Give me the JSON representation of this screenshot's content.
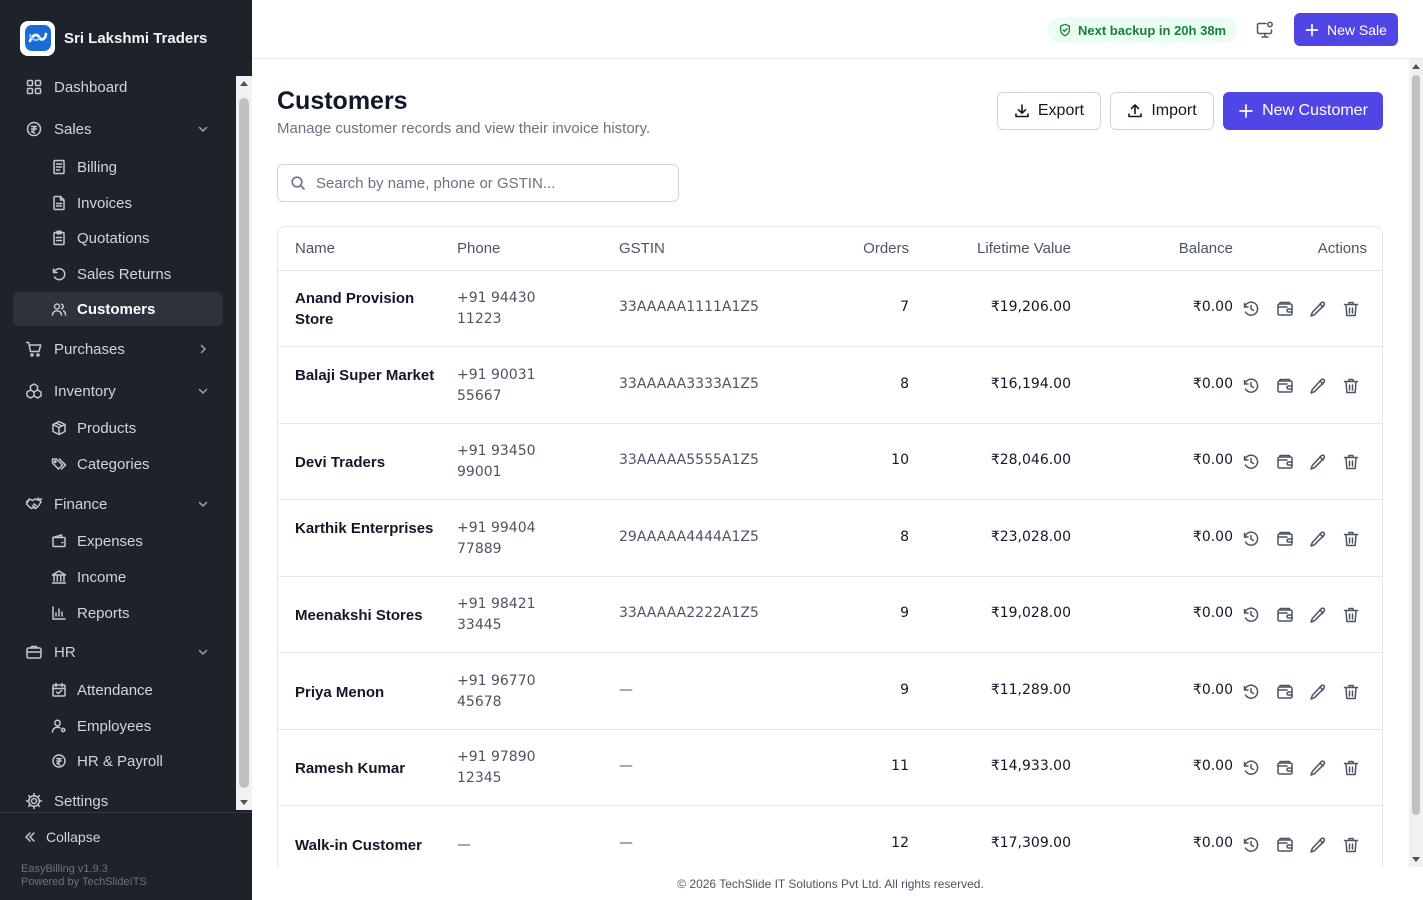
{
  "app": {
    "brand_name": "Sri Lakshmi Traders",
    "accent": "#4f46e5",
    "sidebar_bg": "#1e222a"
  },
  "sidebar": {
    "items": [
      {
        "label": "Dashboard",
        "icon": "dashboard-grid-icon",
        "level": "top"
      },
      {
        "label": "Sales",
        "icon": "sales-coin-icon",
        "level": "top",
        "expanded": true
      },
      {
        "label": "Billing",
        "icon": "billing-icon",
        "level": "sub"
      },
      {
        "label": "Invoices",
        "icon": "invoice-file-icon",
        "level": "sub"
      },
      {
        "label": "Quotations",
        "icon": "clipboard-icon",
        "level": "sub"
      },
      {
        "label": "Sales Returns",
        "icon": "return-arrow-icon",
        "level": "sub"
      },
      {
        "label": "Customers",
        "icon": "users-icon",
        "level": "sub",
        "active": true
      },
      {
        "label": "Purchases",
        "icon": "cart-icon",
        "level": "top",
        "expanded": false
      },
      {
        "label": "Inventory",
        "icon": "boxes-icon",
        "level": "top",
        "expanded": true
      },
      {
        "label": "Products",
        "icon": "package-icon",
        "level": "sub"
      },
      {
        "label": "Categories",
        "icon": "tags-icon",
        "level": "sub"
      },
      {
        "label": "Finance",
        "icon": "handshake-icon",
        "level": "top",
        "expanded": true
      },
      {
        "label": "Expenses",
        "icon": "wallet-icon",
        "level": "sub"
      },
      {
        "label": "Income",
        "icon": "bank-icon",
        "level": "sub"
      },
      {
        "label": "Reports",
        "icon": "bar-chart-icon",
        "level": "sub"
      },
      {
        "label": "HR",
        "icon": "briefcase-icon",
        "level": "top",
        "expanded": true
      },
      {
        "label": "Attendance",
        "icon": "calendar-check-icon",
        "level": "sub"
      },
      {
        "label": "Employees",
        "icon": "user-cog-icon",
        "level": "sub"
      },
      {
        "label": "HR & Payroll",
        "icon": "payroll-coin-icon",
        "level": "sub"
      },
      {
        "label": "Settings",
        "icon": "gear-icon",
        "level": "top"
      }
    ],
    "collapse_label": "Collapse",
    "version": "EasyBilling v1.9.3",
    "powered_by": "Powered by TechSlideITS"
  },
  "topbar": {
    "backup_text": "Next backup in 20h 38m",
    "new_sale_label": "New Sale"
  },
  "page": {
    "title": "Customers",
    "subtitle": "Manage customer records and view their invoice history.",
    "export_label": "Export",
    "import_label": "Import",
    "new_customer_label": "New Customer",
    "search_placeholder": "Search by name, phone or GSTIN..."
  },
  "table": {
    "headers": {
      "name": "Name",
      "phone": "Phone",
      "gstin": "GSTIN",
      "orders": "Orders",
      "lifetime": "Lifetime Value",
      "balance": "Balance",
      "actions": "Actions"
    },
    "rows": [
      {
        "name": "Anand Provision Store",
        "phone": "+91 94430 11223",
        "gstin": "33AAAAA1111A1Z5",
        "orders": "7",
        "lifetime": "₹19,206.00",
        "balance": "₹0.00"
      },
      {
        "name": "Balaji Super Market",
        "phone": "+91 90031 55667",
        "gstin": "33AAAAA3333A1Z5",
        "orders": "8",
        "lifetime": "₹16,194.00",
        "balance": "₹0.00"
      },
      {
        "name": "Devi Traders",
        "phone": "+91 93450 99001",
        "gstin": "33AAAAA5555A1Z5",
        "orders": "10",
        "lifetime": "₹28,046.00",
        "balance": "₹0.00"
      },
      {
        "name": "Karthik Enterprises",
        "phone": "+91 99404 77889",
        "gstin": "29AAAAA4444A1Z5",
        "orders": "8",
        "lifetime": "₹23,028.00",
        "balance": "₹0.00"
      },
      {
        "name": "Meenakshi Stores",
        "phone": "+91 98421 33445",
        "gstin": "33AAAAA2222A1Z5",
        "orders": "9",
        "lifetime": "₹19,028.00",
        "balance": "₹0.00"
      },
      {
        "name": "Priya Menon",
        "phone": "+91 96770 45678",
        "gstin": "—",
        "orders": "9",
        "lifetime": "₹11,289.00",
        "balance": "₹0.00"
      },
      {
        "name": "Ramesh Kumar",
        "phone": "+91 97890 12345",
        "gstin": "—",
        "orders": "11",
        "lifetime": "₹14,933.00",
        "balance": "₹0.00"
      },
      {
        "name": "Walk-in Customer",
        "phone": "—",
        "gstin": "—",
        "orders": "12",
        "lifetime": "₹17,309.00",
        "balance": "₹0.00"
      }
    ]
  },
  "footer": {
    "copyright": "© 2026 TechSlide IT Solutions Pvt Ltd. All rights reserved."
  }
}
